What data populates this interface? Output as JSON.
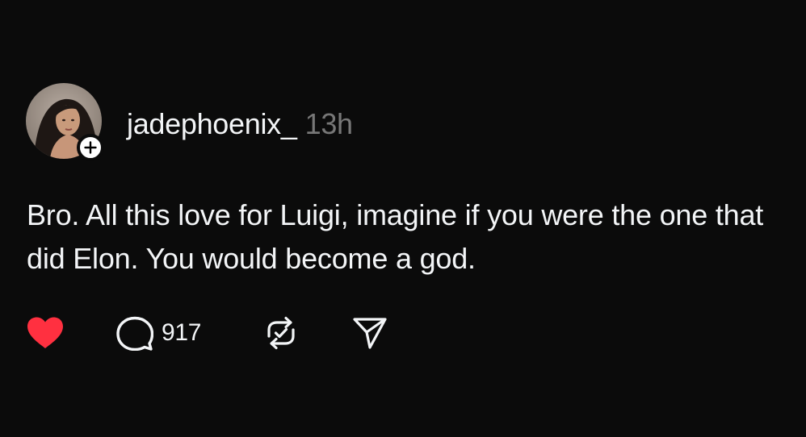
{
  "post": {
    "author": {
      "username": "jadephoenix_",
      "avatar": "profile-photo",
      "follow_icon": "plus-icon"
    },
    "timestamp": "13h",
    "text": "Bro. All this love for Luigi, imagine if you were the one that did Elon. You would become a god.",
    "actions": {
      "like": {
        "icon": "heart-icon",
        "liked": true,
        "color": "#ff3040"
      },
      "reply": {
        "icon": "comment-icon",
        "count": "917"
      },
      "repost": {
        "icon": "repost-icon"
      },
      "share": {
        "icon": "send-icon"
      }
    }
  },
  "theme": {
    "background": "#0b0b0b",
    "text": "#f3f5f7",
    "muted": "#777777"
  }
}
